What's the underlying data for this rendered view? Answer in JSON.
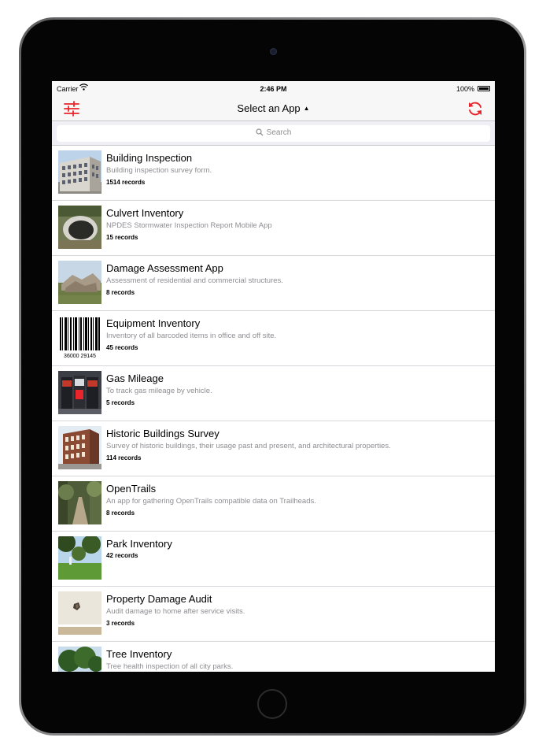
{
  "status_bar": {
    "carrier": "Carrier",
    "time": "2:46 PM",
    "battery": "100%"
  },
  "nav": {
    "title": "Select an App",
    "title_caret_icon": "caret-up-icon",
    "left_icon": "sliders-icon",
    "right_icon": "refresh-icon",
    "accent_color": "#e8252a"
  },
  "search": {
    "placeholder": "Search",
    "icon": "search-icon"
  },
  "apps": [
    {
      "name": "Building Inspection",
      "description": "Building inspection survey form.",
      "records": "1514 records",
      "thumbnail": "building-photo"
    },
    {
      "name": "Culvert Inventory",
      "description": "NPDES Stormwater Inspection Report Mobile App",
      "records": "15 records",
      "thumbnail": "culvert-photo"
    },
    {
      "name": "Damage Assessment App",
      "description": "Assessment of residential and commercial structures.",
      "records": "8 records",
      "thumbnail": "damage-photo"
    },
    {
      "name": "Equipment Inventory",
      "description": "Inventory of all barcoded items in office and off site.",
      "records": "45 records",
      "thumbnail": "barcode-image",
      "barcode_digits": "36000 29145"
    },
    {
      "name": "Gas Mileage",
      "description": "To track gas mileage by vehicle.",
      "records": "5 records",
      "thumbnail": "gas-pump-photo"
    },
    {
      "name": "Historic Buildings Survey",
      "description": "Survey of historic buildings, their usage past and present, and architectural properties.",
      "records": "114 records",
      "thumbnail": "historic-building-photo"
    },
    {
      "name": "OpenTrails",
      "description": "An app for gathering OpenTrails compatible data on Trailheads.",
      "records": "8 records",
      "thumbnail": "trail-photo"
    },
    {
      "name": "Park Inventory",
      "description": "",
      "records": "42 records",
      "thumbnail": "park-photo"
    },
    {
      "name": "Property Damage Audit",
      "description": "Audit damage to home after service visits.",
      "records": "3 records",
      "thumbnail": "wall-damage-photo"
    },
    {
      "name": "Tree Inventory",
      "description": "Tree health inspection of all city parks.",
      "records": "",
      "thumbnail": "tree-photo"
    }
  ]
}
